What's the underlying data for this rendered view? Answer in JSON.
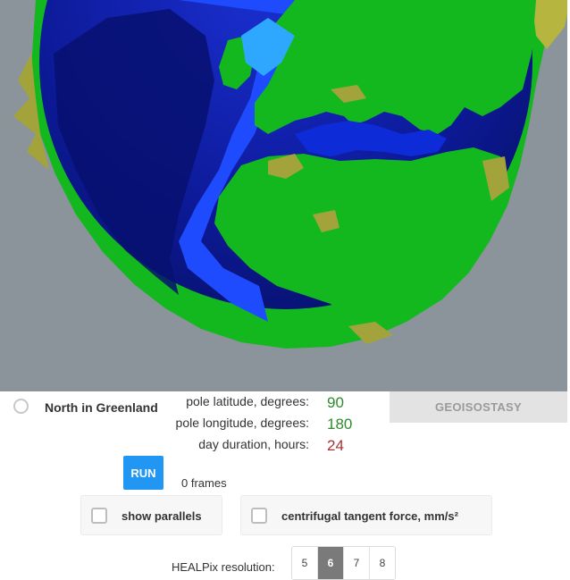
{
  "options": {
    "north_label": "North in Greenland"
  },
  "params": {
    "pole_latitude_label": "pole latitude, degrees:",
    "pole_latitude_value": "90",
    "pole_longitude_label": "pole longitude, degrees:",
    "pole_longitude_value": "180",
    "day_duration_label": "day duration, hours:",
    "day_duration_value": "24"
  },
  "buttons": {
    "geoisostasy": "GEOISOSTASY",
    "run": "RUN"
  },
  "status": {
    "frames": "0 frames"
  },
  "checks": {
    "show_parallels": "show parallels",
    "centrifugal": "centrifugal tangent force, mm/s²"
  },
  "healpix": {
    "label": "HEALPix resolution:",
    "options": [
      "5",
      "6",
      "7",
      "8"
    ],
    "selected": "6"
  },
  "colors": {
    "background": "#8b939b",
    "ocean_deep": "#0a1a8a",
    "ocean_shallow": "#1f4bff",
    "land": "#13b81f",
    "highland": "#9a9a32",
    "accent": "#2196f3",
    "value_green": "#2e8b2e",
    "value_red": "#a83232"
  }
}
